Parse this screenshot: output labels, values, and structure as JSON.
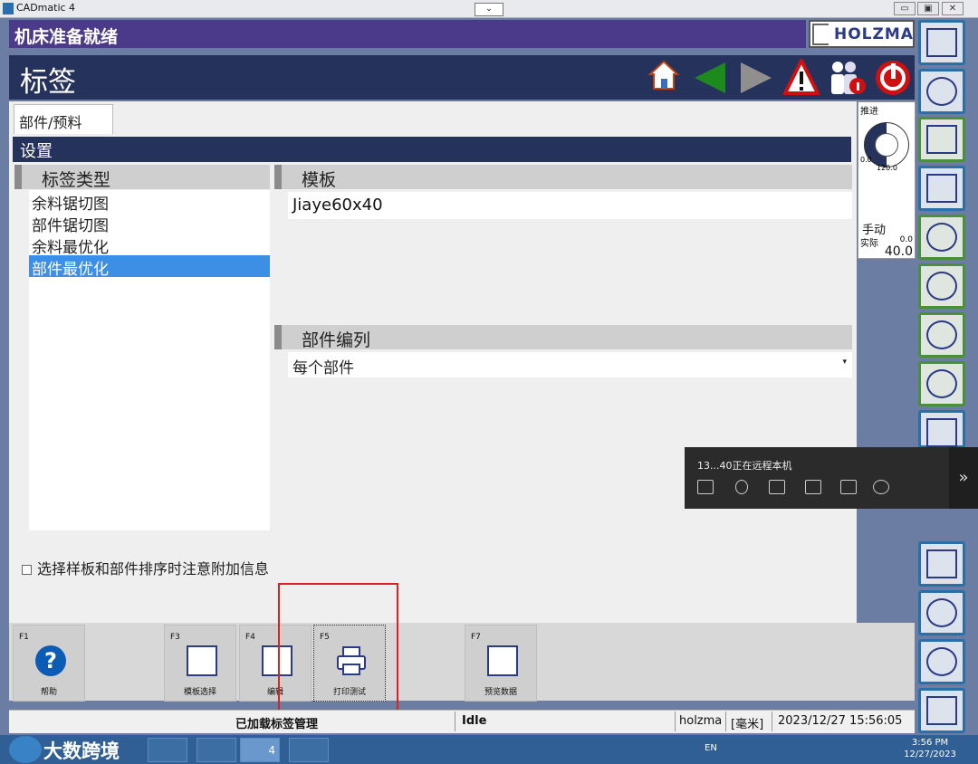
{
  "window": {
    "app_title": "CADmatic 4",
    "dropdown_glyph": "⌄",
    "min": "▭",
    "max": "▣",
    "close": "✕"
  },
  "machine_status": "机床准备就绪",
  "brand": "HOLZMA",
  "page_title": "标签",
  "toolbar_icons": [
    "home-icon",
    "back-arrow-icon",
    "forward-arrow-icon",
    "warning-icon",
    "operators-icon",
    "power-icon"
  ],
  "tab": "部件/预料",
  "settings_header": "设置",
  "label_type": {
    "header": "标签类型",
    "items": [
      {
        "label": "余料锯切图",
        "selected": false
      },
      {
        "label": "部件锯切图",
        "selected": false
      },
      {
        "label": "余料最优化",
        "selected": false
      },
      {
        "label": "部件最优化",
        "selected": true
      }
    ]
  },
  "template": {
    "header": "模板",
    "value": "Jiaye60x40"
  },
  "sequence": {
    "header": "部件编列",
    "value": "每个部件"
  },
  "checkbox": {
    "label": "选择样板和部件排序时注意附加信息",
    "checked": false
  },
  "feed_panel": {
    "title": "推进",
    "gauge_min": "0.0",
    "gauge_max": "120.0",
    "mode": "手动",
    "actual_label": "实际",
    "actual_small": "0.0",
    "actual_value": "40.0"
  },
  "side_buttons": [
    "feed-icon",
    "saw-settings-icon",
    "pressure-beam-icon",
    "label-printer-icon",
    "saw-blade-measure-icon",
    "main-saw-icon",
    "scoring-saw-icon",
    "clamp-icon",
    "saw-grid-icon",
    "pattern-grid-icon",
    "saw-tool-icon",
    "saw-wrench-icon",
    "stack-icon"
  ],
  "fkeys": [
    {
      "key": "F1",
      "label": "帮助",
      "icon": "?"
    },
    {
      "key": "F3",
      "label": "模板选择"
    },
    {
      "key": "F4",
      "label": "编辑"
    },
    {
      "key": "F5",
      "label": "打印测试"
    },
    {
      "key": "F7",
      "label": "预览数据"
    }
  ],
  "statusbar": {
    "message": "已加载标签管理",
    "state": "Idle",
    "user": "holzma",
    "unit": "[毫米]",
    "datetime": "2023/12/27 15:56:05"
  },
  "remote": {
    "text": "13...40正在远程本机",
    "expand": "»"
  },
  "taskbar": {
    "watermark": "大数跨境",
    "lang": "EN",
    "time": "3:56 PM",
    "date": "12/27/2023",
    "badge": "4"
  }
}
